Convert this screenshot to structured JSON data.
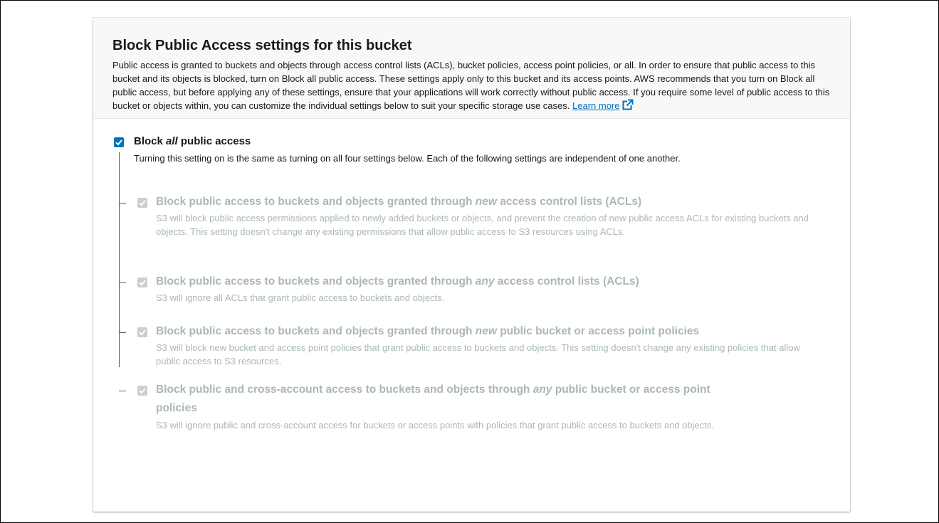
{
  "section": {
    "title": "Block Public Access settings for this bucket",
    "description": "Public access is granted to buckets and objects through access control lists (ACLs), bucket policies, access point policies, or all. In order to ensure that public access to this bucket and its objects is blocked, turn on Block all public access. These settings apply only to this bucket and its access points. AWS recommends that you turn on Block all public access, but before applying any of these settings, ensure that your applications will work correctly without public access. If you require some level of public access to this bucket or objects within, you can customize the individual settings below to suit your specific storage use cases.",
    "learn_more": "Learn more",
    "external_icon": "external-link-icon"
  },
  "master": {
    "label_pre": "Block ",
    "label_em": "all",
    "label_post": " public access",
    "checked": true,
    "description": "Turning this setting on is the same as turning on all four settings below. Each of the following settings are independent of one another."
  },
  "options": [
    {
      "title_pre": "Block public access to buckets and objects granted through ",
      "title_em": "new",
      "title_post": " access control lists (ACLs)",
      "description": "S3 will block public access permissions applied to newly added buckets or objects, and prevent the creation of new public access ACLs for existing buckets and objects. This setting doesn't change any existing permissions that allow public access to S3 resources using ACLs.",
      "checked": true,
      "disabled": true
    },
    {
      "title_pre": "Block public access to buckets and objects granted through ",
      "title_em": "any",
      "title_post": " access control lists (ACLs)",
      "description": "S3 will ignore all ACLs that grant public access to buckets and objects.",
      "checked": true,
      "disabled": true
    },
    {
      "title_pre": "Block public access to buckets and objects granted through ",
      "title_em": "new",
      "title_post": " public bucket or access point policies",
      "description": "S3 will block new bucket and access point policies that grant public access to buckets and objects. This setting doesn't change any existing policies that allow public access to S3 resources.",
      "checked": true,
      "disabled": true
    },
    {
      "title_pre": "Block public and cross-account access to buckets and objects through ",
      "title_em": "any",
      "title_post": " public bucket or access point",
      "title_line2": "policies",
      "description": "S3 will ignore public and cross-account access for buckets or access points with policies that grant public access to buckets and objects.",
      "checked": true,
      "disabled": true
    }
  ],
  "colors": {
    "accent": "#0073bb",
    "disabled_text": "#aab7b8",
    "disabled_checkbox": "#c9ced4"
  }
}
